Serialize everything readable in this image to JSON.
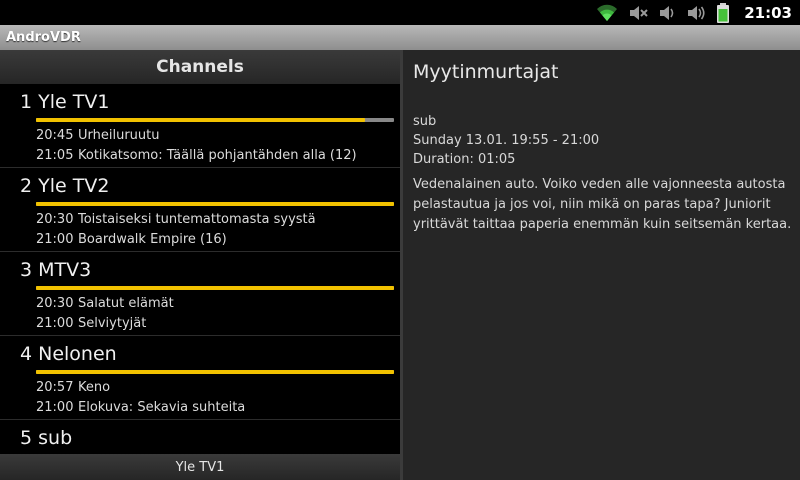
{
  "status_bar": {
    "clock": "21:03",
    "icons": [
      "wifi-icon",
      "volume-muted-icon",
      "volume-icon",
      "vibrate-icon",
      "battery-icon"
    ]
  },
  "title_bar": {
    "title": "AndroVDR"
  },
  "channels_panel": {
    "header": "Channels",
    "footer": "Yle TV1",
    "channels": [
      {
        "number_name": "1 Yle TV1",
        "progress": 0.92,
        "programs": [
          {
            "time": "20:45",
            "title": "Urheiluruutu"
          },
          {
            "time": "21:05",
            "title": "Kotikatsomo: Täällä pohjantähden alla (12)"
          }
        ]
      },
      {
        "number_name": "2 Yle TV2",
        "progress": 1.0,
        "programs": [
          {
            "time": "20:30",
            "title": "Toistaiseksi tuntemattomasta syystä"
          },
          {
            "time": "21:00",
            "title": "Boardwalk Empire (16)"
          }
        ]
      },
      {
        "number_name": "3 MTV3",
        "progress": 1.0,
        "programs": [
          {
            "time": "20:30",
            "title": "Salatut elämät"
          },
          {
            "time": "21:00",
            "title": "Selviytyjät"
          }
        ]
      },
      {
        "number_name": "4 Nelonen",
        "progress": 1.0,
        "programs": [
          {
            "time": "20:57",
            "title": "Keno"
          },
          {
            "time": "21:00",
            "title": "Elokuva: Sekavia suhteita"
          }
        ]
      },
      {
        "number_name": "5 sub",
        "progress": null,
        "programs": []
      }
    ]
  },
  "detail": {
    "title": "Myytinmurtajat",
    "channel": "sub",
    "time": "Sunday 13.01. 19:55 - 21:00",
    "duration": "Duration:  01:05",
    "description": "Vedenalainen auto. Voiko veden alle vajonneesta autosta pelastautua ja jos voi, niin mikä on paras tapa? Juniorit yrittävät taittaa paperia enemmän kuin seitsemän kertaa."
  },
  "colors": {
    "accent_progress": "#f2c200",
    "progress_track": "#888888",
    "detail_background": "#262626"
  }
}
